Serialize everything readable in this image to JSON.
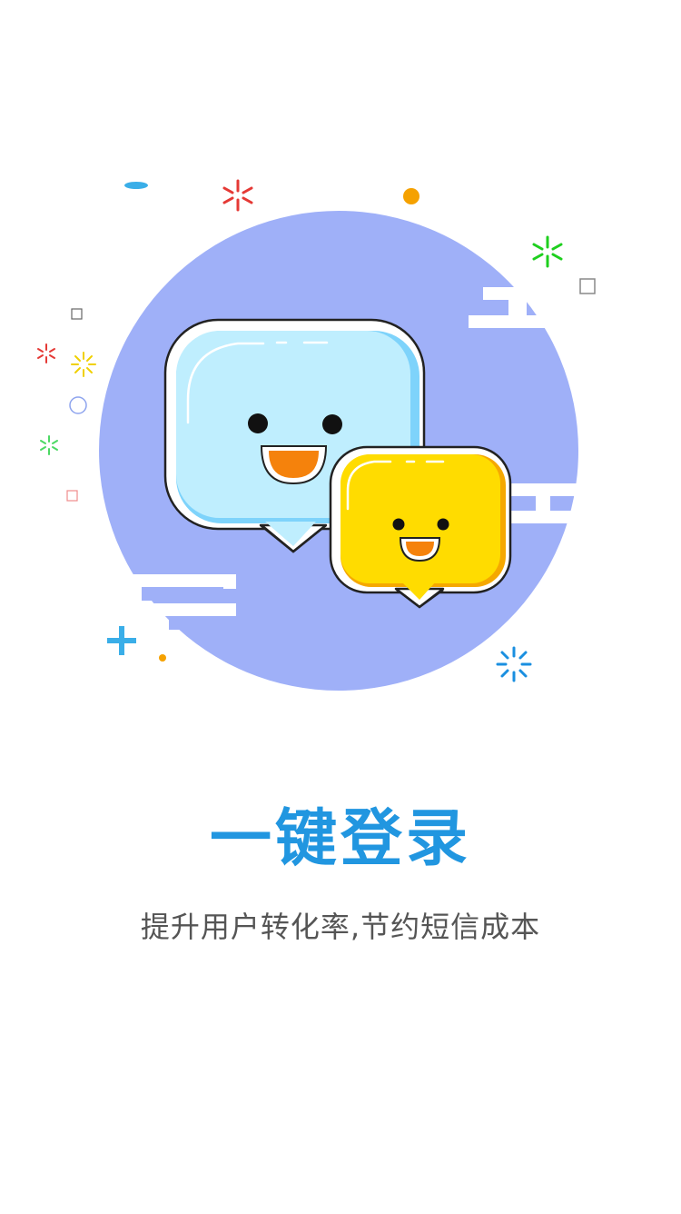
{
  "onboarding": {
    "title": "一键登录",
    "subtitle": "提升用户转化率,节约短信成本"
  },
  "illustration": {
    "subject": "two smiling chat bubbles",
    "colors": {
      "circle": "#9fb0f8",
      "bubble_large": "#bfeefe",
      "bubble_small": "#ffdc00",
      "mouth": "#f5820c",
      "accent_blue": "#3aaee8",
      "accent_orange": "#f5a100"
    }
  },
  "theme": {
    "title_color": "#2196e0",
    "subtitle_color": "#555555"
  }
}
